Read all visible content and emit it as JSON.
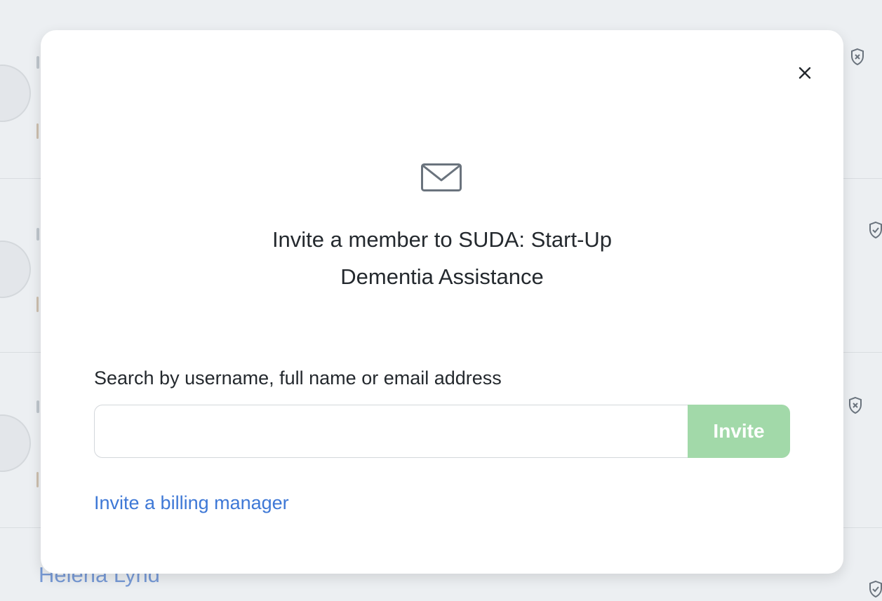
{
  "background": {
    "visible_member_name": "Helena Lynd",
    "row_status_icons": [
      "shield-x-icon",
      "shield-check-icon",
      "shield-x-icon",
      "shield-check-icon"
    ]
  },
  "modal": {
    "icon": "mail-icon",
    "title": "Invite a member to SUDA: Start-Up Dementia Assistance",
    "search_label": "Search by username, full name or email address",
    "search_value": "",
    "invite_button_label": "Invite",
    "invite_button_enabled": false,
    "billing_link_label": "Invite a billing manager",
    "close_icon": "close-icon"
  },
  "colors": {
    "invite_button_disabled": "#a2d9a9",
    "link": "#3e78d6",
    "overlay_background": "#eceff2"
  }
}
